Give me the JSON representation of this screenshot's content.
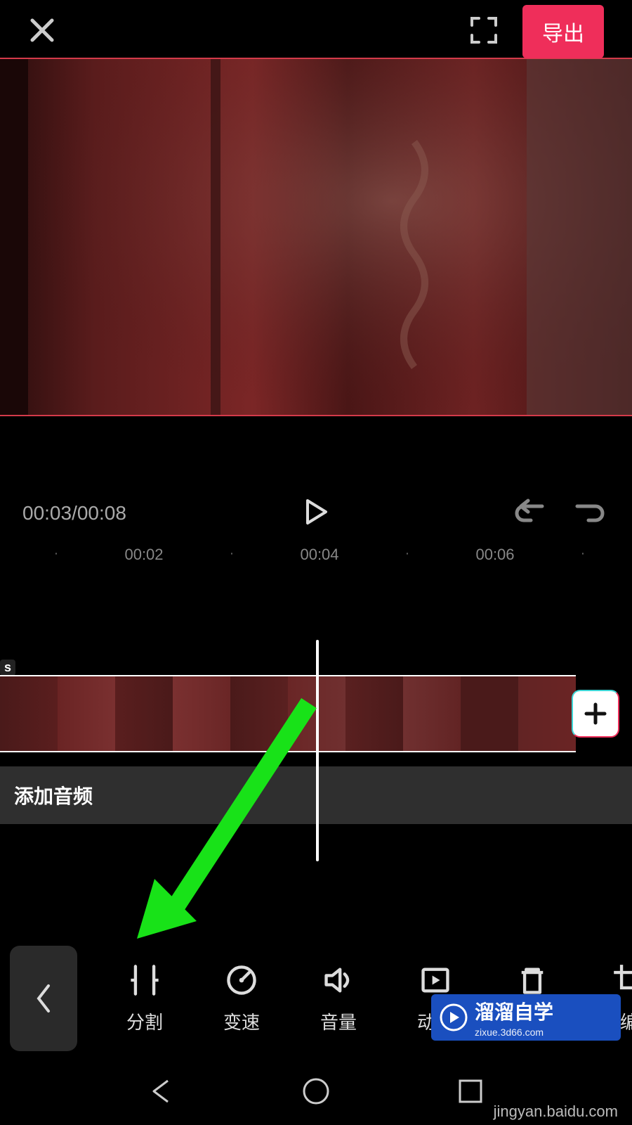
{
  "topbar": {
    "export_label": "导出"
  },
  "controls": {
    "timecode_current": "00:03",
    "timecode_total": "00:08"
  },
  "ruler": {
    "ticks": [
      {
        "pos": 80,
        "label": "·",
        "dot": true
      },
      {
        "pos": 205,
        "label": "00:02"
      },
      {
        "pos": 330,
        "label": "·",
        "dot": true
      },
      {
        "pos": 455,
        "label": "00:04"
      },
      {
        "pos": 580,
        "label": "·",
        "dot": true
      },
      {
        "pos": 705,
        "label": "00:06"
      },
      {
        "pos": 830,
        "label": "·",
        "dot": true
      }
    ]
  },
  "timeline": {
    "clip_duration_label": "s",
    "audio_row_label": "添加音频"
  },
  "toolbar": {
    "items": [
      {
        "id": "split",
        "label": "分割",
        "icon": "split-icon"
      },
      {
        "id": "speed",
        "label": "变速",
        "icon": "speed-icon"
      },
      {
        "id": "volume",
        "label": "音量",
        "icon": "volume-icon"
      },
      {
        "id": "anim",
        "label": "动画",
        "icon": "animation-icon"
      },
      {
        "id": "delete",
        "label": "删除",
        "icon": "delete-icon"
      },
      {
        "id": "edit",
        "label": "编",
        "icon": "crop-icon"
      }
    ]
  },
  "watermark": {
    "brand": "溜溜自学",
    "sub": "zixue.3d66.com",
    "attribution": "jingyan.baidu.com"
  },
  "colors": {
    "accent": "#ef2e5a",
    "arrow": "#18e218"
  }
}
